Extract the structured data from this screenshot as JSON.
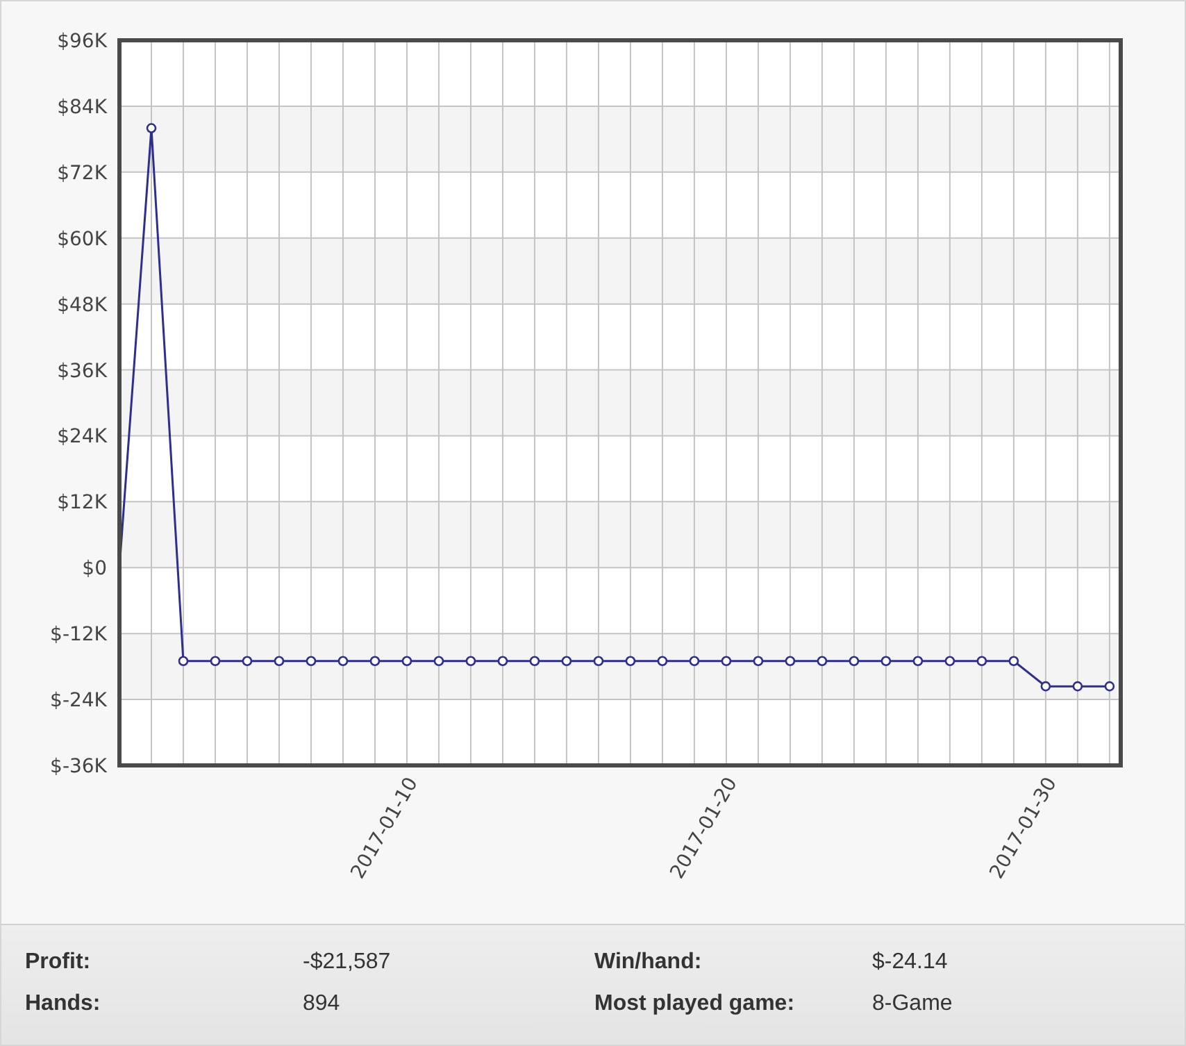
{
  "chart_data": {
    "type": "line",
    "categories": [
      null,
      null,
      null,
      null,
      null,
      null,
      null,
      null,
      null,
      "2017-01-10",
      null,
      null,
      null,
      null,
      null,
      null,
      null,
      null,
      null,
      "2017-01-20",
      null,
      null,
      null,
      null,
      null,
      null,
      null,
      null,
      null,
      "2017-01-30",
      null,
      null
    ],
    "grid": true,
    "series": [
      {
        "color": "#2e2e8f",
        "marker": true,
        "values": [
          0,
          80000,
          -17000,
          -17000,
          -17000,
          -17000,
          -17000,
          -17000,
          -17000,
          -17000,
          -17000,
          -17000,
          -17000,
          -17000,
          -17000,
          -17000,
          -17000,
          -17000,
          -17000,
          -17000,
          -17000,
          -17000,
          -17000,
          -17000,
          -17000,
          -17000,
          -17000,
          -17000,
          -17000,
          -21600,
          -21600,
          -21600
        ]
      }
    ],
    "ylim": [
      -36000,
      96000
    ],
    "yticks": [
      {
        "value": 96000,
        "label": "$96K"
      },
      {
        "value": 84000,
        "label": "$84K"
      },
      {
        "value": 72000,
        "label": "$72K"
      },
      {
        "value": 60000,
        "label": "$60K"
      },
      {
        "value": 48000,
        "label": "$48K"
      },
      {
        "value": 36000,
        "label": "$36K"
      },
      {
        "value": 24000,
        "label": "$24K"
      },
      {
        "value": 12000,
        "label": "$12K"
      },
      {
        "value": 0,
        "label": "$0"
      },
      {
        "value": -12000,
        "label": "$-12K"
      },
      {
        "value": -24000,
        "label": "$-24K"
      },
      {
        "value": -36000,
        "label": "$-36K"
      }
    ]
  },
  "stats": [
    {
      "label": "Profit:",
      "value": "-$21,587"
    },
    {
      "label": "Win/hand:",
      "value": "$-24.14"
    },
    {
      "label": "Hands:",
      "value": "894"
    },
    {
      "label": "Most played game:",
      "value": "8-Game"
    }
  ]
}
